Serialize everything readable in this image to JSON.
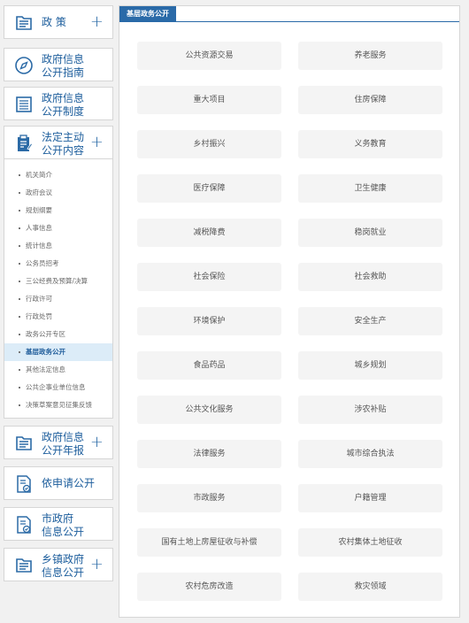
{
  "sidebar": {
    "policy": {
      "label": "政    策"
    },
    "guide": {
      "label_line1": "政府信息",
      "label_line2": "公开指南"
    },
    "system": {
      "label_line1": "政府信息",
      "label_line2": "公开制度"
    },
    "statutory": {
      "label_line1": "法定主动",
      "label_line2": "公开内容"
    },
    "sub_items": [
      "机关简介",
      "政府会议",
      "规划纲要",
      "人事信息",
      "统计信息",
      "公务员招考",
      "三公经费及预算/决算",
      "行政许可",
      "行政处罚",
      "政务公开专区",
      "基层政务公开",
      "其他法定信息",
      "公共企事业单位信息",
      "决策草案意见征集反馈"
    ],
    "annual": {
      "label_line1": "政府信息",
      "label_line2": "公开年报"
    },
    "apply": {
      "label": "依申请公开"
    },
    "municipal": {
      "label_line1": "市政府",
      "label_line2": "信息公开"
    },
    "township": {
      "label_line1": "乡镇政府",
      "label_line2": "信息公开"
    },
    "plus": "+"
  },
  "panel": {
    "tab_title": "基层政务公开",
    "tiles": [
      "公共资源交易",
      "养老服务",
      "重大项目",
      "住房保障",
      "乡村振兴",
      "义务教育",
      "医疗保障",
      "卫生健康",
      "减税降费",
      "稳岗就业",
      "社会保险",
      "社会救助",
      "环境保护",
      "安全生产",
      "食品药品",
      "城乡规划",
      "公共文化服务",
      "涉农补贴",
      "法律服务",
      "城市综合执法",
      "市政服务",
      "户籍管理",
      "国有土地上房屋征收与补偿",
      "农村集体土地征收",
      "农村危房改造",
      "救灾领域"
    ]
  },
  "colors": {
    "accent": "#2a6aa8",
    "active_bg": "#dcecf8",
    "tile_bg": "#f4f4f4"
  }
}
